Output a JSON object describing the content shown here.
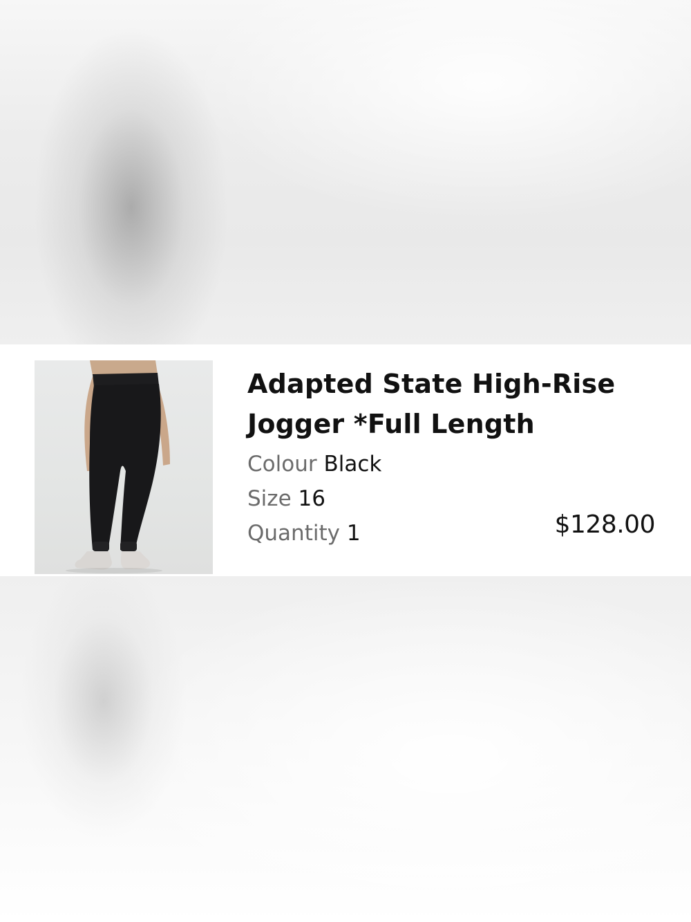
{
  "product": {
    "name": "Adapted State High-Rise Jogger *Full Length",
    "image_icon": "product-photo-jogger",
    "colour_label": "Colour",
    "colour_value": "Black",
    "size_label": "Size",
    "size_value": "16",
    "quantity_label": "Quantity",
    "quantity_value": "1",
    "price": "$128.00"
  }
}
